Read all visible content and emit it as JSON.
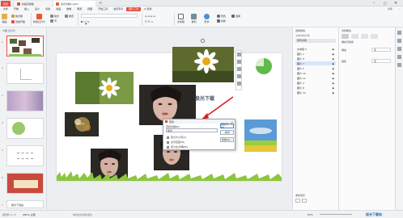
{
  "titlebar": {
    "home_tab": "首页",
    "tabs": [
      {
        "label": "找稻壳模板",
        "color": "#e84c3d"
      },
      {
        "label": "演示文稿1.pptx",
        "color": "#e8582d"
      }
    ],
    "right_icons": [
      "minimize-icon",
      "maximize-icon",
      "close-icon"
    ]
  },
  "menubar": {
    "items": [
      "文件",
      "开始",
      "插入",
      "设计",
      "切换",
      "动画",
      "放映",
      "审阅",
      "视图",
      "开发工具",
      "会员专享",
      "图片工具",
      "Q 查找"
    ],
    "active_index": 11,
    "right_items": [
      "分享",
      "…"
    ]
  },
  "ribbon": {
    "groups": [
      "粘贴",
      "格式刷",
      "当前开始",
      "新建幻灯片",
      "版式",
      "节",
      "重置",
      "文本框",
      "排列",
      "形状",
      "查找",
      "替换",
      "选择"
    ]
  },
  "left_panel": {
    "header": "大纲  幻灯片",
    "slide_numbers": [
      "1",
      "2",
      "3",
      "4",
      "5",
      "6",
      "7"
    ],
    "last_thumb_text": "极光下载站"
  },
  "slide": {
    "watermark_text": "极光下载",
    "small_label": "Happy"
  },
  "find_dialog": {
    "title": "查找",
    "find_label": "查找内容(N):",
    "find_value": "极光",
    "buttons": [
      "查找下一个(F)",
      "关闭",
      "替换(R)..."
    ],
    "options": [
      "区分大小写(C)",
      "全字匹配(W)",
      "区分全/半角(M)"
    ]
  },
  "selection_pane": {
    "title": "选择窗格",
    "subtitle": "文档中的对象",
    "header_label": "所有对象",
    "items": [
      "文本框 5",
      "图片 1",
      "图片 9",
      "图片 7",
      "图片 5",
      "图片 10",
      "图片 11",
      "图片 3",
      "图片 8",
      "图片 12"
    ],
    "highlight_index": 3,
    "bottom_label": "重新排序"
  },
  "property_pane": {
    "title": "对象属性",
    "tabs": [
      "填充与线条",
      "效果",
      "大小与属性",
      "图片"
    ],
    "rows": [
      "填充",
      "线条"
    ],
    "values": [
      "无",
      "无"
    ]
  },
  "statusbar": {
    "left_text": "幻灯片 1 / 7",
    "theme_text": "Office 主题",
    "notes_hint": "单击此处添加备注",
    "zoom": "63%",
    "brand": "极光下载站"
  },
  "colors": {
    "accent": "#e84c3d",
    "selection_blue": "#d7e7fb",
    "active_tab": "#e84c3d",
    "arrow": "#d42020",
    "green_circle": "#5fbb4c"
  }
}
